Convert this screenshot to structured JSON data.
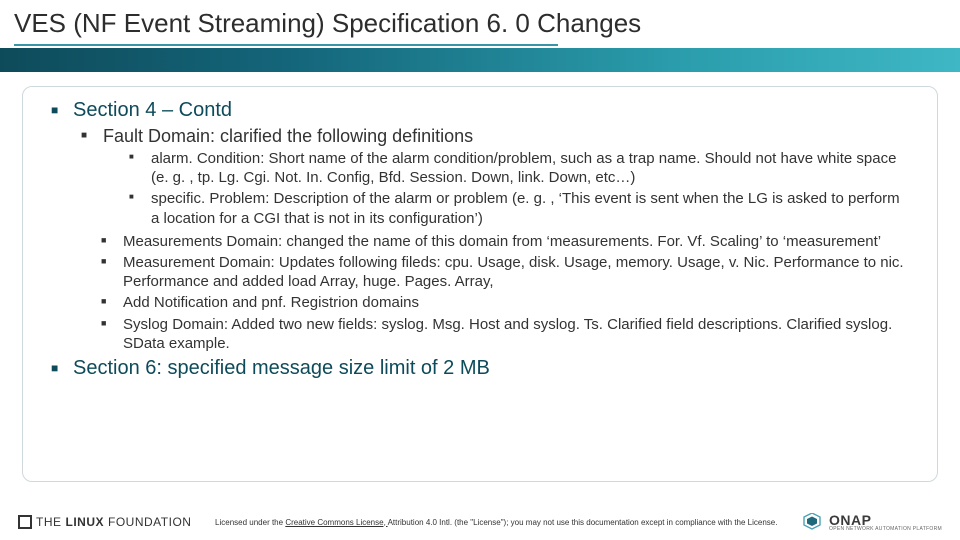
{
  "title": "VES (NF Event Streaming) Specification 6. 0 Changes",
  "section4": {
    "heading": "Section 4 – Contd",
    "fault_domain": "Fault Domain: clarified the following definitions",
    "defs": {
      "alarm": "alarm. Condition: Short name of the alarm condition/problem, such as a trap name.  Should not have white space (e. g. , tp. Lg. Cgi. Not. In. Config, Bfd. Session. Down, link. Down, etc…)",
      "specific": "specific. Problem: Description of the alarm or problem (e. g. , ‘This event is sent when the LG is asked to perform a location for a CGI that is not in its configuration’)"
    },
    "items": {
      "measurements1": "Measurements Domain: changed the name of this domain from ‘measurements. For. Vf. Scaling’ to ‘measurement’",
      "measurements2": "Measurement Domain: Updates following fileds: cpu. Usage, disk. Usage, memory. Usage, v. Nic. Performance to nic. Performance and added load Array, huge. Pages. Array,",
      "notification": "Add Notification and pnf. Registrion domains",
      "syslog": "Syslog Domain: Added two new fields: syslog. Msg. Host and syslog. Ts.  Clarified field descriptions.  Clarified syslog. SData example."
    }
  },
  "section6": "Section 6: specified message size limit of 2 MB",
  "footer": {
    "lf_the": "THE",
    "lf_linux": "LINUX",
    "lf_foundation": "FOUNDATION",
    "license_pre": "Licensed under the ",
    "license_link": "Creative Commons License, ",
    "license_post": "Attribution 4.0 Intl. (the \"License\"); you may not use this documentation except in compliance with the License.",
    "onap_main": "ONAP",
    "onap_sub": "OPEN NETWORK AUTOMATION PLATFORM"
  }
}
